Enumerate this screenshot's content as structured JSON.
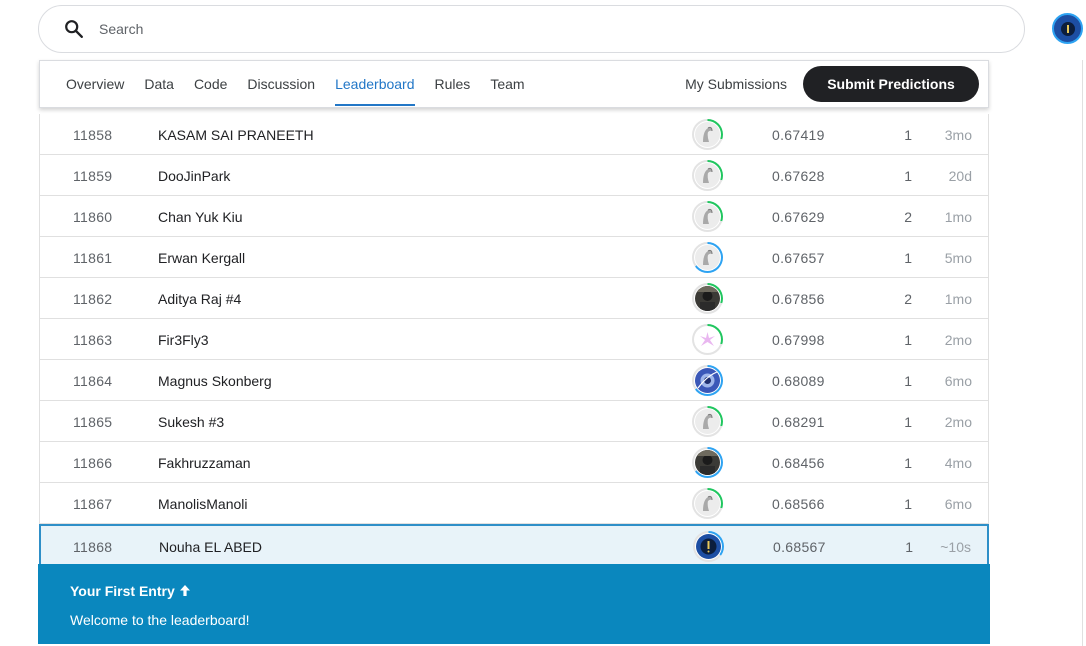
{
  "search": {
    "placeholder": "Search"
  },
  "tabs": [
    "Overview",
    "Data",
    "Code",
    "Discussion",
    "Leaderboard",
    "Rules",
    "Team"
  ],
  "active_tab": "Leaderboard",
  "my_submissions_label": "My Submissions",
  "submit_label": "Submit Predictions",
  "rows": [
    {
      "rank": "11858",
      "name": "KASAM SAI PRANEETH",
      "score": "0.67419",
      "entries": "1",
      "last": "3mo",
      "avatar": "default"
    },
    {
      "rank": "11859",
      "name": "DooJinPark",
      "score": "0.67628",
      "entries": "1",
      "last": "20d",
      "avatar": "default"
    },
    {
      "rank": "11860",
      "name": "Chan Yuk Kiu",
      "score": "0.67629",
      "entries": "2",
      "last": "1mo",
      "avatar": "default"
    },
    {
      "rank": "11861",
      "name": "Erwan Kergall",
      "score": "0.67657",
      "entries": "1",
      "last": "5mo",
      "avatar": "default"
    },
    {
      "rank": "11862",
      "name": "Aditya Raj #4",
      "score": "0.67856",
      "entries": "2",
      "last": "1mo",
      "avatar": "photo-dark"
    },
    {
      "rank": "11863",
      "name": "Fir3Fly3",
      "score": "0.67998",
      "entries": "1",
      "last": "2mo",
      "avatar": "pink"
    },
    {
      "rank": "11864",
      "name": "Magnus Skonberg",
      "score": "0.68089",
      "entries": "1",
      "last": "6mo",
      "avatar": "blue-art"
    },
    {
      "rank": "11865",
      "name": "Sukesh #3",
      "score": "0.68291",
      "entries": "1",
      "last": "2mo",
      "avatar": "default"
    },
    {
      "rank": "11866",
      "name": "Fakhruzzaman",
      "score": "0.68456",
      "entries": "1",
      "last": "4mo",
      "avatar": "photo-dark"
    },
    {
      "rank": "11867",
      "name": "ManolisManoli",
      "score": "0.68566",
      "entries": "1",
      "last": "6mo",
      "avatar": "default"
    },
    {
      "rank": "11868",
      "name": "Nouha EL ABED",
      "score": "0.68567",
      "entries": "1",
      "last": "~10s",
      "avatar": "user"
    }
  ],
  "banner": {
    "title": "Your First Entry",
    "message": "Welcome to the leaderboard!"
  },
  "colors": {
    "accent": "#2277c7",
    "banner": "#0a87be",
    "highlight_row": "#e8f3f9",
    "ring_green": "#20c65f",
    "ring_blue": "#2ea3f2"
  }
}
